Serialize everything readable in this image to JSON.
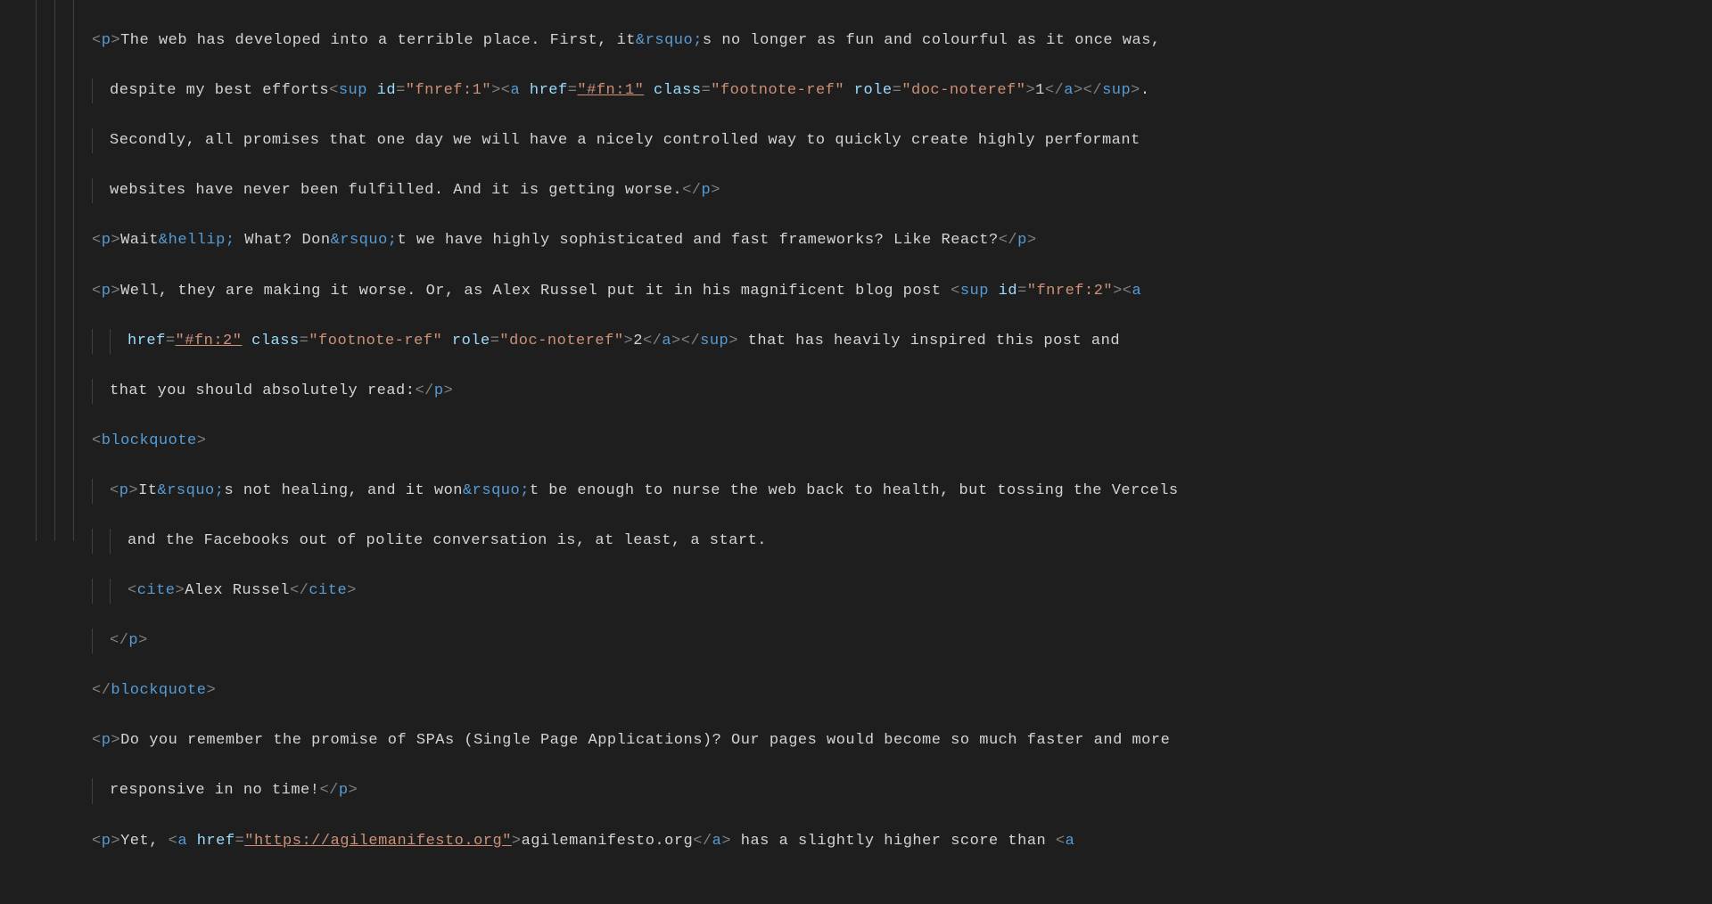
{
  "code": {
    "l1a": "<",
    "l1b": "p",
    "l1c": ">",
    "l1d": "The web has developed into a terrible place. First, it",
    "l1e": "&rsquo;",
    "l1f": "s no longer as fun and colourful as it once was,",
    "l2a": "despite my best efforts",
    "l2b": "<",
    "l2c": "sup",
    "l2d": " id",
    "l2e": "=",
    "l2f": "\"fnref:1\"",
    "l2g": "><",
    "l2h": "a",
    "l2i": " href",
    "l2j": "=",
    "l2k": "\"#fn:1\"",
    "l2l": " class",
    "l2m": "=",
    "l2n": "\"footnote-ref\"",
    "l2o": " role",
    "l2p": "=",
    "l2q": "\"doc-noteref\"",
    "l2r": ">",
    "l2s": "1",
    "l2t": "</",
    "l2u": "a",
    "l2v": "></",
    "l2w": "sup",
    "l2x": ">",
    "l2y": ".",
    "l3": "Secondly, all promises that one day we will have a nicely controlled way to quickly create highly performant",
    "l4a": "websites have never been fulfilled. And it is getting worse.",
    "l4b": "</",
    "l4c": "p",
    "l4d": ">",
    "l5a": "<",
    "l5b": "p",
    "l5c": ">",
    "l5d": "Wait",
    "l5e": "&hellip;",
    "l5f": " What? Don",
    "l5g": "&rsquo;",
    "l5h": "t we have highly sophisticated and fast frameworks? Like React?",
    "l5i": "</",
    "l5j": "p",
    "l5k": ">",
    "l6a": "<",
    "l6b": "p",
    "l6c": ">",
    "l6d": "Well, they are making it worse. Or, as Alex Russel put it in his magnificent blog post ",
    "l6e": "<",
    "l6f": "sup",
    "l6g": " id",
    "l6h": "=",
    "l6i": "\"fnref:2\"",
    "l6j": "><",
    "l6k": "a",
    "l7a": "href",
    "l7b": "=",
    "l7c": "\"#fn:2\"",
    "l7d": " class",
    "l7e": "=",
    "l7f": "\"footnote-ref\"",
    "l7g": " role",
    "l7h": "=",
    "l7i": "\"doc-noteref\"",
    "l7j": ">",
    "l7k": "2",
    "l7l": "</",
    "l7m": "a",
    "l7n": "></",
    "l7o": "sup",
    "l7p": ">",
    "l7q": " that has heavily inspired this post and",
    "l8a": "that you should absolutely read:",
    "l8b": "</",
    "l8c": "p",
    "l8d": ">",
    "l9a": "<",
    "l9b": "blockquote",
    "l9c": ">",
    "l10a": "<",
    "l10b": "p",
    "l10c": ">",
    "l10d": "It",
    "l10e": "&rsquo;",
    "l10f": "s not healing, and it won",
    "l10g": "&rsquo;",
    "l10h": "t be enough to nurse the web back to health, but tossing the Vercels",
    "l11": "and the Facebooks out of polite conversation is, at least, a start.",
    "l12a": "<",
    "l12b": "cite",
    "l12c": ">",
    "l12d": "Alex Russel",
    "l12e": "</",
    "l12f": "cite",
    "l12g": ">",
    "l13a": "</",
    "l13b": "p",
    "l13c": ">",
    "l14a": "</",
    "l14b": "blockquote",
    "l14c": ">",
    "l15a": "<",
    "l15b": "p",
    "l15c": ">",
    "l15d": "Do you remember the promise of SPAs (Single Page Applications)? Our pages would become so much faster and more",
    "l16a": "responsive in no time!",
    "l16b": "</",
    "l16c": "p",
    "l16d": ">",
    "l17a": "<",
    "l17b": "p",
    "l17c": ">",
    "l17d": "Yet, ",
    "l17e": "<",
    "l17f": "a",
    "l17g": " href",
    "l17h": "=",
    "l17i": "\"https://agilemanifesto.org\"",
    "l17j": ">",
    "l17k": "agilemanifesto.org",
    "l17l": "</",
    "l17m": "a",
    "l17n": ">",
    "l17o": " has a slightly higher score than ",
    "l17p": "<",
    "l17q": "a"
  }
}
